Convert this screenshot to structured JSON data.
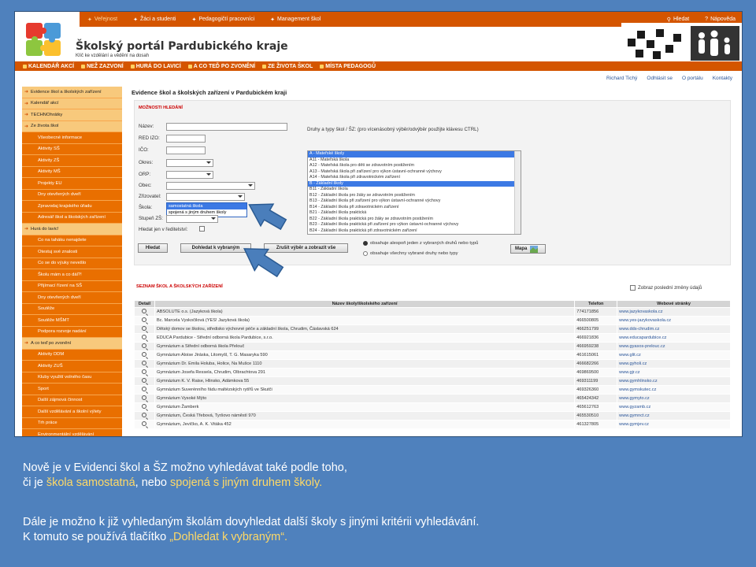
{
  "top_nav": {
    "items": [
      "Veřejnost",
      "Žáci a studenti",
      "Pedagogičtí pracovníci",
      "Management škol"
    ],
    "right": [
      "Hledat",
      "Nápověda"
    ]
  },
  "portal": {
    "title": "Školský portál Pardubického kraje",
    "subtitle": "Klíč ke vzdělání a vědění na dosah"
  },
  "main_menu": [
    "KALENDÁŘ AKCÍ",
    "NEŽ ZAZVONÍ",
    "HURÁ DO LAVICÍ",
    "A CO TEĎ PO ZVONĚNÍ",
    "ZE ŽIVOTA ŠKOL",
    "MÍSTA PEDAGOGŮ"
  ],
  "user_links": [
    "Richard Tichý",
    "Odhlásit se",
    "O portálu",
    "Kontakty"
  ],
  "sidebar": [
    {
      "label": "Evidence škol a školských zařízení",
      "kind": "top"
    },
    {
      "label": "Kalendář akcí",
      "kind": "top"
    },
    {
      "label": "TECHNOhrátky",
      "kind": "top"
    },
    {
      "label": "Ze života škol",
      "kind": "top"
    },
    {
      "label": "Všeobecné informace",
      "kind": "sub"
    },
    {
      "label": "Aktivity SŠ",
      "kind": "sub"
    },
    {
      "label": "Aktivity ZŠ",
      "kind": "sub"
    },
    {
      "label": "Aktivity MŠ",
      "kind": "sub"
    },
    {
      "label": "Projekty EU",
      "kind": "sub"
    },
    {
      "label": "Dny otevřených dveří",
      "kind": "sub"
    },
    {
      "label": "Zpravodaj krajského úřadu",
      "kind": "sub"
    },
    {
      "label": "Adresář škol a školských zařízení",
      "kind": "sub"
    },
    {
      "label": "Hurá do lavic!",
      "kind": "top"
    },
    {
      "label": "Co na taháku nenajdete",
      "kind": "sub"
    },
    {
      "label": "Otestuj své znalosti",
      "kind": "sub"
    },
    {
      "label": "Co se do výuky nevešlo",
      "kind": "sub"
    },
    {
      "label": "Školu mám a co dál?!",
      "kind": "sub"
    },
    {
      "label": "Přijímací řízení na SŠ",
      "kind": "sub"
    },
    {
      "label": "Dny otevřených dveří",
      "kind": "sub"
    },
    {
      "label": "Soutěže",
      "kind": "sub"
    },
    {
      "label": "Soutěže MŠMT",
      "kind": "sub"
    },
    {
      "label": "Podpora rozvoje nadání",
      "kind": "sub"
    },
    {
      "label": "A co teď po zvonění",
      "kind": "top"
    },
    {
      "label": "Aktivity DDM",
      "kind": "sub"
    },
    {
      "label": "Aktivity ZUŠ",
      "kind": "sub"
    },
    {
      "label": "Kluby využití volného času",
      "kind": "sub"
    },
    {
      "label": "Sport",
      "kind": "sub"
    },
    {
      "label": "Další zájmová činnost",
      "kind": "sub"
    },
    {
      "label": "Další vzdělávání a školní výlety",
      "kind": "sub"
    },
    {
      "label": "Trh práce",
      "kind": "sub"
    },
    {
      "label": "Environmentální vzdělávání",
      "kind": "sub"
    }
  ],
  "page": {
    "title": "Evidence škol a školských zařízení v Pardubickém kraji",
    "search_section": "MOŽNOSTI HLEDÁNÍ",
    "fields": {
      "nazev": "Název:",
      "red_izo": "RED IZO:",
      "ico": "IČO:",
      "okres": "Okres:",
      "orp": "ORP:",
      "obec": "Obec:",
      "zrizovatel": "Zřizovatel:",
      "skola": "Škola:",
      "stupen": "Stupeň ZŠ:",
      "reditelstvi": "Hledat jen v ředitelství:"
    },
    "skola_options": [
      "samostatná škola",
      "spojená s jiným druhem školy"
    ],
    "types_label": "Druhy a typy škol / ŠZ:   (pro vícenásobný výběr/odvýběr použijte klávesu CTRL)",
    "types": [
      {
        "text": "A - Mateřské školy",
        "sel": true
      },
      {
        "text": "A11 - Mateřská škola",
        "sel": false
      },
      {
        "text": "A12 - Mateřská škola pro děti se zdravotním postižením",
        "sel": false
      },
      {
        "text": "A13 - Mateřská škola při zařízení pro výkon ústavní-ochranné výchovy",
        "sel": false
      },
      {
        "text": "A14 - Mateřská škola při zdravotnickém zařízení",
        "sel": false
      },
      {
        "text": "B - Základní školy",
        "sel": true
      },
      {
        "text": "B11 - Základní škola",
        "sel": false
      },
      {
        "text": "B12 - Základní škola pro žáky se zdravotním postižením",
        "sel": false
      },
      {
        "text": "B13 - Základní škola při zařízení pro výkon ústavní-ochranné výchovy",
        "sel": false
      },
      {
        "text": "B14 - Základní škola při zdravotnickém zařízení",
        "sel": false
      },
      {
        "text": "B21 - Základní škola praktická",
        "sel": false
      },
      {
        "text": "B22 - Základní škola praktická pro žáky se zdravotním postižením",
        "sel": false
      },
      {
        "text": "B23 - Základní škola praktická při zařízení pro výkon ústavní-ochranné výchovy",
        "sel": false
      },
      {
        "text": "B24 - Základní škola praktická při zdravotnickém zařízení",
        "sel": false
      }
    ],
    "buttons": {
      "hledat": "Hledat",
      "dohledat": "Dohledat k vybraným",
      "zrusit": "Zrušit výběr a zobrazit vše",
      "mapa": "Mapa"
    },
    "radio1": "obsahuje alespoň jeden z vybraných druhů nebo typů",
    "radio2": "obsahuje všechny vybrané druhy nebo typy",
    "list_section": "SEZNAM ŠKOL A ŠKOLSKÝCH ZAŘÍZENÍ",
    "recent_changes": "Zobraz poslední změny údajů",
    "table_headers": [
      "Detail",
      "Název školy/školského zařízení",
      "Telefon",
      "Webové stránky"
    ],
    "rows": [
      [
        "ABSOLUTE o.s. (Jazyková škola)",
        "774171856",
        "www.jazykovaskola.cz"
      ],
      [
        "Bc. Marcela Vyskočilová (YES! Jazyková škola)",
        "466500805",
        "www.yes-jazykovaskola.cz"
      ],
      [
        "Dětský domov se školou, středisko výchovné péče a základní škola, Chrudim, Čáslavská 624",
        "466251799",
        "www.dds-chrudim.cz"
      ],
      [
        "EDUCA Pardubice - Střední odborná škola Pardubice, s.r.o.",
        "466921836",
        "www.educapardubice.cz"
      ],
      [
        "Gymnázium a Střední odborná škola Přelouč",
        "466959238",
        "www.gyasos-prelouc.cz"
      ],
      [
        "Gymnázium Aloise Jiráska, Litomyšl, T. G. Masaryka 590",
        "461615061",
        "www.glit.cz"
      ],
      [
        "Gymnázium Dr. Emila Holuba, Holice, Na Mušce 1110",
        "466682266",
        "www.gyholi.cz"
      ],
      [
        "Gymnázium Josefa Ressela, Chrudim, Olbrachtova 291",
        "469869500",
        "www.gjr.cz"
      ],
      [
        "Gymnázium K. V. Raise, Hlinsko, Adámkova 55",
        "469311199",
        "www.gymhlinsko.cz"
      ],
      [
        "Gymnázium Suverénního řádu maltézských rytířů ve Skutči",
        "469326360",
        "www.gymskutec.cz"
      ],
      [
        "Gymnázium Vysoké Mýto",
        "465424342",
        "www.gymyto.cz"
      ],
      [
        "Gymnázium Žamberk",
        "465612763",
        "www.gyzamb.cz"
      ],
      [
        "Gymnázium, Česká Třebová, Tyršovo náměstí 970",
        "465530510",
        "www.gymnct.cz"
      ],
      [
        "Gymnázium, Jevíčko, A. K. Vitáka 452",
        "461327805",
        "www.gymjev.cz"
      ]
    ]
  },
  "caption": {
    "line1a": "Nově je v Evidenci škol a ŠZ možno vyhledávat také podle toho,",
    "line2a": "či je ",
    "line2b": "škola samostatná",
    "line2c": ", nebo ",
    "line2d": "spojená s jiným druhem školy.",
    "line3": "Dále je možno k již vyhledaným školám dovyhledat další školy s jinými kritérii vyhledávání.",
    "line4a": "K tomuto se používá tlačítko ",
    "line4b": "„Dohledat k vybraným“."
  },
  "colors": {
    "orange": "#d45500",
    "sidebar": "#e96f00",
    "background": "#4f81bd",
    "highlight": "#3c79e4",
    "arrow": "#4a7ebb"
  }
}
